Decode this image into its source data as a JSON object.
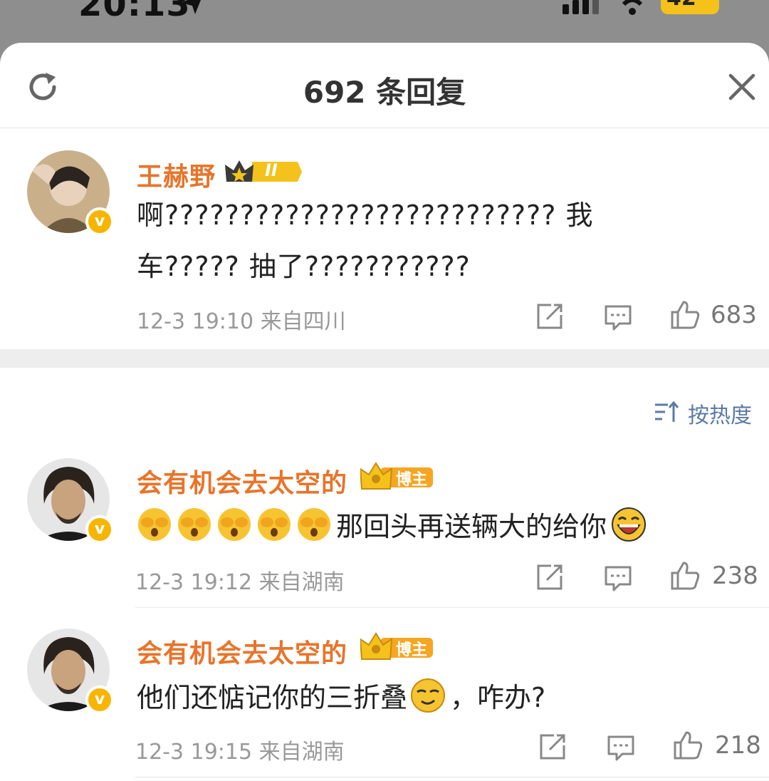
{
  "status_bar": {
    "time": "20:13",
    "battery": "42"
  },
  "sheet": {
    "title": "692 条回复"
  },
  "main_comment": {
    "username": "王赫野",
    "badge_level": "II",
    "text_line1": "啊?????????????????????????? 我",
    "text_line2": "车????? 抽了???????????",
    "meta": "12-3 19:10  来自四川",
    "likes": "683"
  },
  "sort": {
    "label": "按热度"
  },
  "replies": [
    {
      "username": "会有机会去太空的",
      "badge_label": "博主",
      "text": "那回头再送辆大的给你",
      "meta": "12-3 19:12  来自湖南",
      "likes": "238"
    },
    {
      "username": "会有机会去太空的",
      "badge_label": "博主",
      "text_before": "他们还惦记你的三折叠",
      "text_after": "，咋办?",
      "meta": "12-3 19:15  来自湖南",
      "likes": "218"
    }
  ],
  "colors": {
    "username": "#e8742a",
    "verified_badge": "#f7b500",
    "sort_link": "#5a7aa6",
    "meta_text": "#999999"
  },
  "icons": {
    "refresh": "refresh-icon",
    "close": "close-icon",
    "share": "share-icon",
    "comment": "comment-icon",
    "like": "thumbs-up-icon",
    "sort": "sort-icon"
  }
}
